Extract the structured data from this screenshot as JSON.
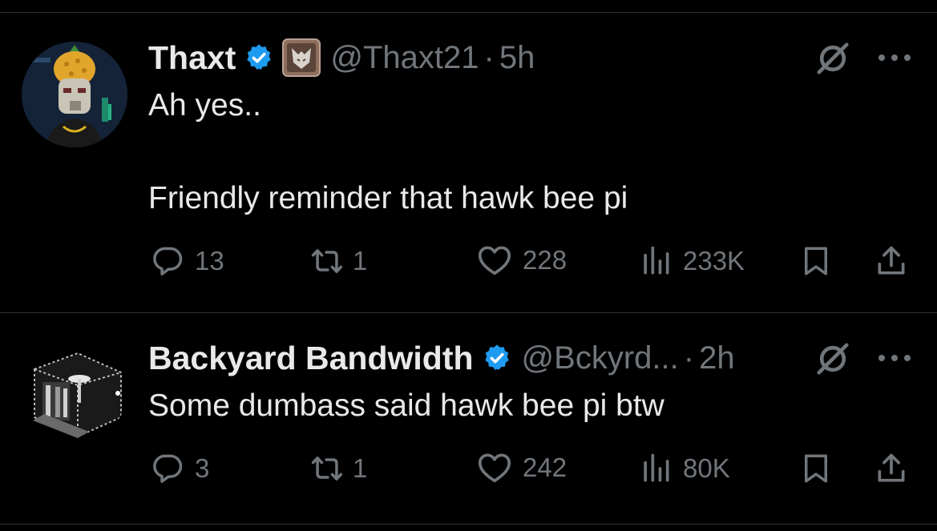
{
  "tweets": [
    {
      "name": "Thaxt",
      "handle": "@Thaxt21",
      "separator": "·",
      "time": "5h",
      "text": "Ah yes..\n\nFriendly reminder that hawk bee pi",
      "replies": "13",
      "reposts": "1",
      "likes": "228",
      "views": "233K",
      "icons": [
        "verified-badge-icon",
        "affiliate-badge-icon",
        "grok-icon",
        "more-icon",
        "reply-icon",
        "repost-icon",
        "like-icon",
        "views-icon",
        "bookmark-icon",
        "share-icon"
      ]
    },
    {
      "name": "Backyard Bandwidth",
      "handle": "@Bckyrd...",
      "separator": "·",
      "time": "2h",
      "text": "Some dumbass said hawk bee pi btw",
      "replies": "3",
      "reposts": "1",
      "likes": "242",
      "views": "80K",
      "icons": [
        "verified-badge-icon",
        "grok-icon",
        "more-icon",
        "reply-icon",
        "repost-icon",
        "like-icon",
        "views-icon",
        "bookmark-icon",
        "share-icon"
      ]
    }
  ],
  "colors": {
    "background": "#000000",
    "text": "#e7e9ea",
    "secondary": "#71767b",
    "verified": "#1d9bf0",
    "divider": "#2f3336"
  }
}
